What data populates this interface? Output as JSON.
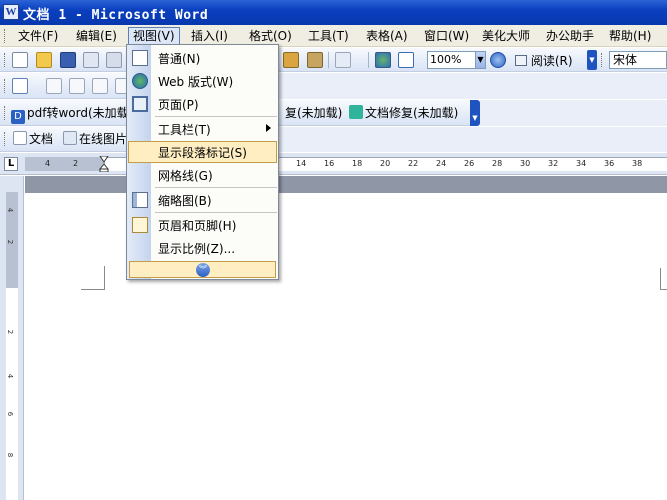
{
  "window": {
    "title": "文档 1 - Microsoft Word"
  },
  "menubar": {
    "items": [
      {
        "label": "文件(F)"
      },
      {
        "label": "编辑(E)"
      },
      {
        "label": "视图(V)"
      },
      {
        "label": "插入(I)"
      },
      {
        "label": "格式(O)"
      },
      {
        "label": "工具(T)"
      },
      {
        "label": "表格(A)"
      },
      {
        "label": "窗口(W)"
      },
      {
        "label": "美化大师"
      },
      {
        "label": "办公助手"
      },
      {
        "label": "帮助(H)"
      }
    ]
  },
  "view_menu": {
    "items": [
      {
        "label": "普通(N)",
        "icon": "normal-view-icon"
      },
      {
        "label": "Web 版式(W)",
        "icon": "web-layout-icon"
      },
      {
        "label": "页面(P)",
        "icon": "print-layout-icon"
      },
      {
        "label": "工具栏(T)",
        "icon": ""
      },
      {
        "label": "显示段落标记(S)",
        "icon": ""
      },
      {
        "label": "网格线(G)",
        "icon": ""
      },
      {
        "label": "缩略图(B)",
        "icon": "thumbnails-icon"
      },
      {
        "label": "页眉和页脚(H)",
        "icon": "header-footer-icon"
      },
      {
        "label": "显示比例(Z)...",
        "icon": ""
      }
    ],
    "highlighted": "显示段落标记(S)",
    "expand_icon": "double-chevron-down-icon"
  },
  "toolbar_standard": {
    "zoom": "100%",
    "read_label": "阅读(R)",
    "font_name": "宋体"
  },
  "toolbar_pdf": {
    "pdf_to_word": "pdf转word(未加载)",
    "doc_repair_left": "复(未加载)",
    "doc_repair": "文档修复(未加载)"
  },
  "toolbar_docs": {
    "doc_label": "文档",
    "online_images": "在线图片"
  },
  "ruler": {
    "ticks": [
      "4",
      "2",
      "14",
      "16",
      "18",
      "20",
      "22",
      "24",
      "26",
      "28",
      "30",
      "32",
      "34",
      "36",
      "38"
    ],
    "vertical_ticks": [
      "4",
      "2",
      "2",
      "4",
      "6",
      "8"
    ]
  }
}
